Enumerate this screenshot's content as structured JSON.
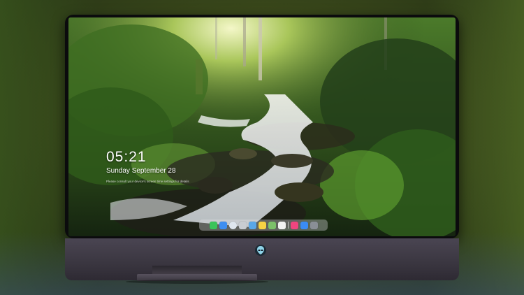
{
  "lockscreen": {
    "time": "05:21",
    "date": "Sunday September  28",
    "notice": "Please consult your device's screen time settings for details"
  },
  "dock": {
    "apps": [
      {
        "name": "messages-icon",
        "color": "#3ac45a"
      },
      {
        "name": "finder-icon",
        "color": "#3e8ef0"
      },
      {
        "name": "safari-icon",
        "color": "#dfe6ee"
      },
      {
        "name": "photos-icon",
        "color": "#c8ccd2"
      },
      {
        "name": "files-icon",
        "color": "#5aa7e8"
      },
      {
        "name": "notes-icon",
        "color": "#f6d244"
      },
      {
        "name": "maps-icon",
        "color": "#7cc06a"
      },
      {
        "name": "calendar-icon",
        "color": "#f2f2f2"
      },
      {
        "name": "music-icon",
        "color": "#f0457f"
      },
      {
        "name": "app-store-icon",
        "color": "#3a8cf6"
      },
      {
        "name": "settings-icon",
        "color": "#8a8f96"
      }
    ]
  },
  "monitor": {
    "chin_logo": "alien-head-logo-icon"
  }
}
